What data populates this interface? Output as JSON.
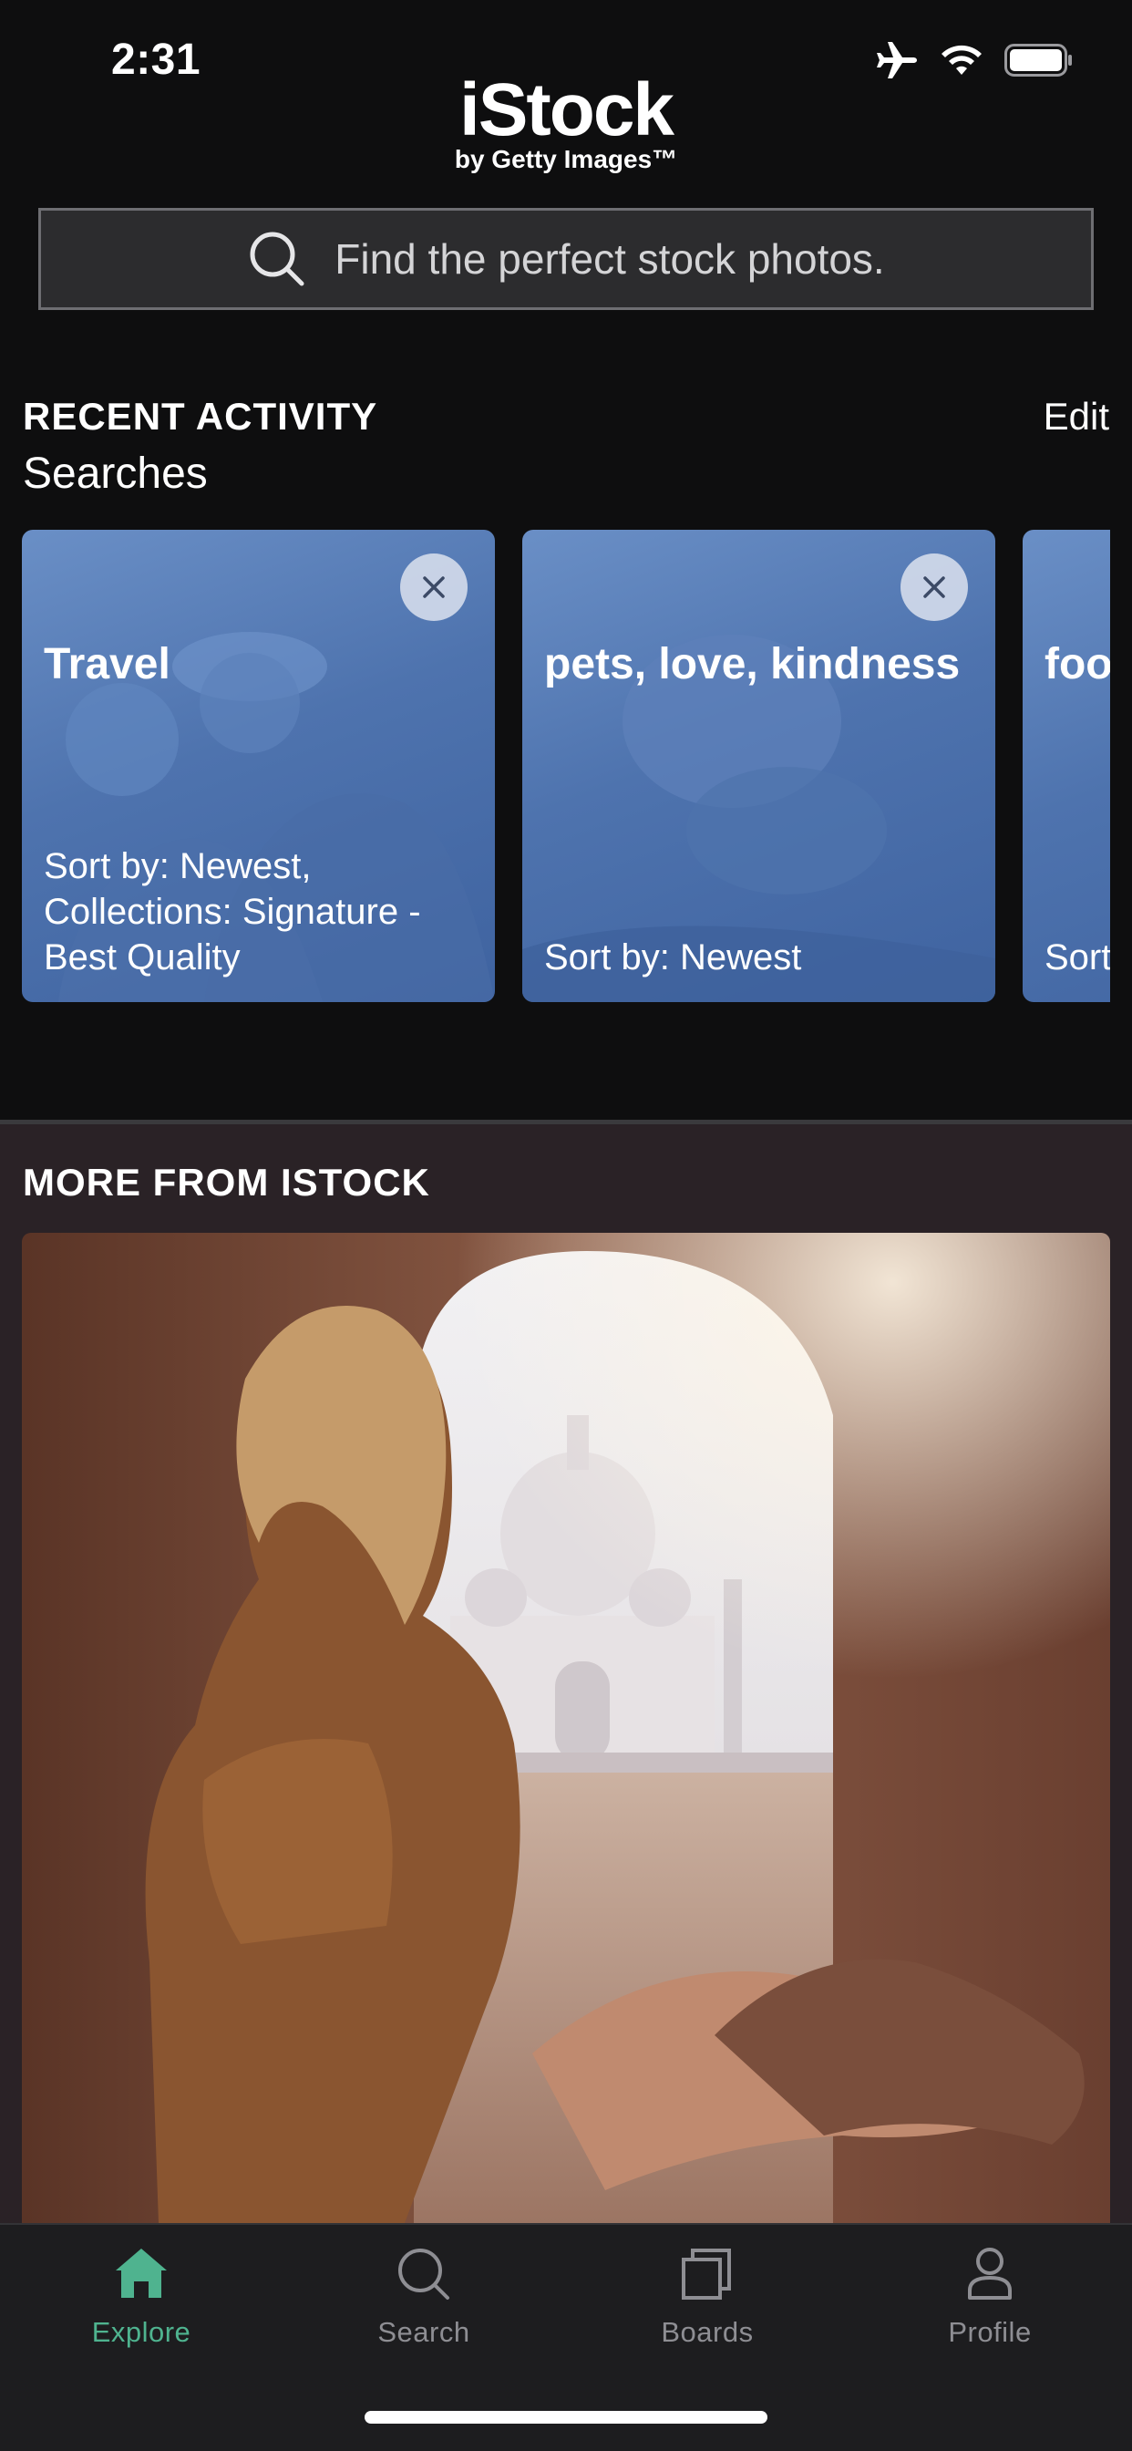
{
  "status_bar": {
    "time": "2:31"
  },
  "logo": {
    "name": "iStock",
    "tagline": "by Getty Images™"
  },
  "search": {
    "placeholder": "Find the perfect stock photos."
  },
  "recent_activity": {
    "title": "RECENT ACTIVITY",
    "edit_label": "Edit",
    "searches_label": "Searches",
    "cards": [
      {
        "title": "Travel",
        "subtitle": "Sort by: Newest, Collections: Signature - Best Quality"
      },
      {
        "title": "pets, love, kindness",
        "subtitle": "Sort by: Newest"
      },
      {
        "title": "foo",
        "subtitle": "Sort"
      }
    ]
  },
  "more_from": {
    "title": "MORE FROM ISTOCK"
  },
  "tab_bar": {
    "active_color": "#4fb38f",
    "tabs": [
      {
        "label": "Explore",
        "icon": "home-icon",
        "active": true
      },
      {
        "label": "Search",
        "icon": "search-icon",
        "active": false
      },
      {
        "label": "Boards",
        "icon": "boards-icon",
        "active": false
      },
      {
        "label": "Profile",
        "icon": "profile-icon",
        "active": false
      }
    ]
  }
}
